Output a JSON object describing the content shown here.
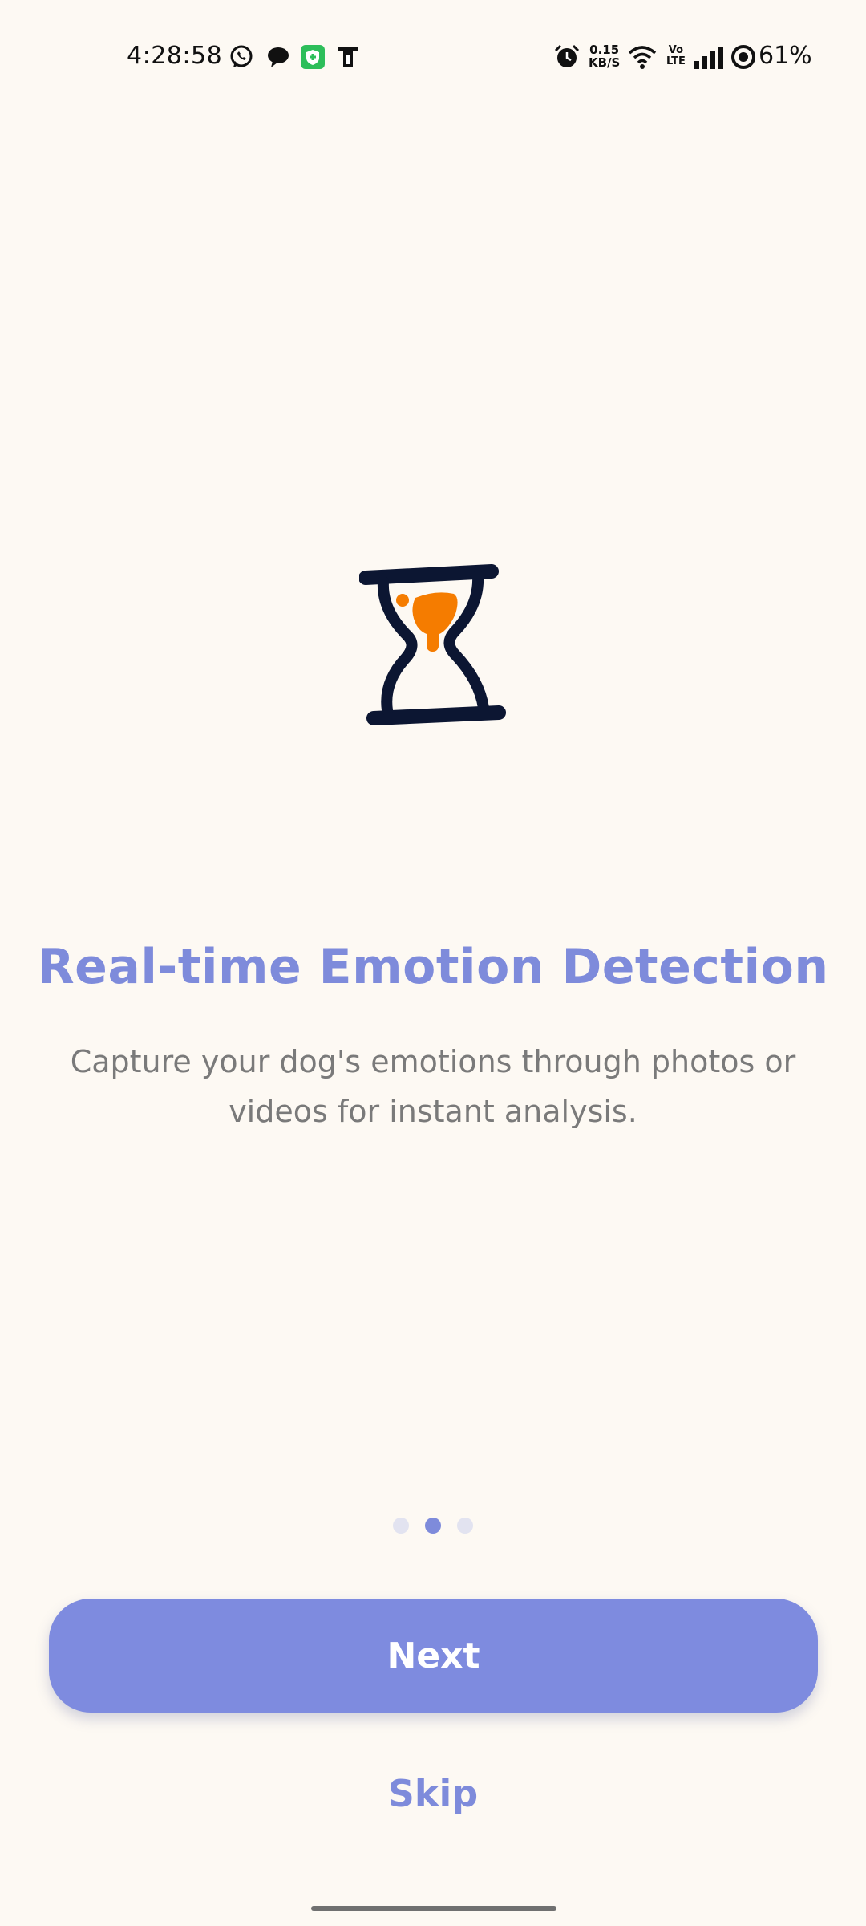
{
  "status_bar": {
    "time": "4:28:58",
    "net_speed_value": "0.15",
    "net_speed_unit": "KB/S",
    "volte_top": "Vo",
    "volte_bottom": "LTE",
    "battery": "61%",
    "left_icons": [
      "whatsapp-icon",
      "message-bubble-icon",
      "shield-app-icon",
      "sim-card-icon"
    ],
    "right_icons": [
      "alarm-icon",
      "wifi-icon",
      "signal-bars-icon",
      "battery-icon"
    ]
  },
  "illustration": {
    "icon": "hourglass-icon",
    "frame_color": "#0C1632",
    "sand_color": "#F57C00"
  },
  "onboarding": {
    "title": "Real-time Emotion Detection",
    "description": "Capture your dog's emotions through photos or videos for instant analysis.",
    "page_count": 3,
    "current_page": 2
  },
  "actions": {
    "next_label": "Next",
    "skip_label": "Skip"
  },
  "colors": {
    "background": "#FDF9F3",
    "accent": "#7E8BDB",
    "description_text": "#7A7A7A",
    "dot_inactive": "#E2E3F0"
  }
}
